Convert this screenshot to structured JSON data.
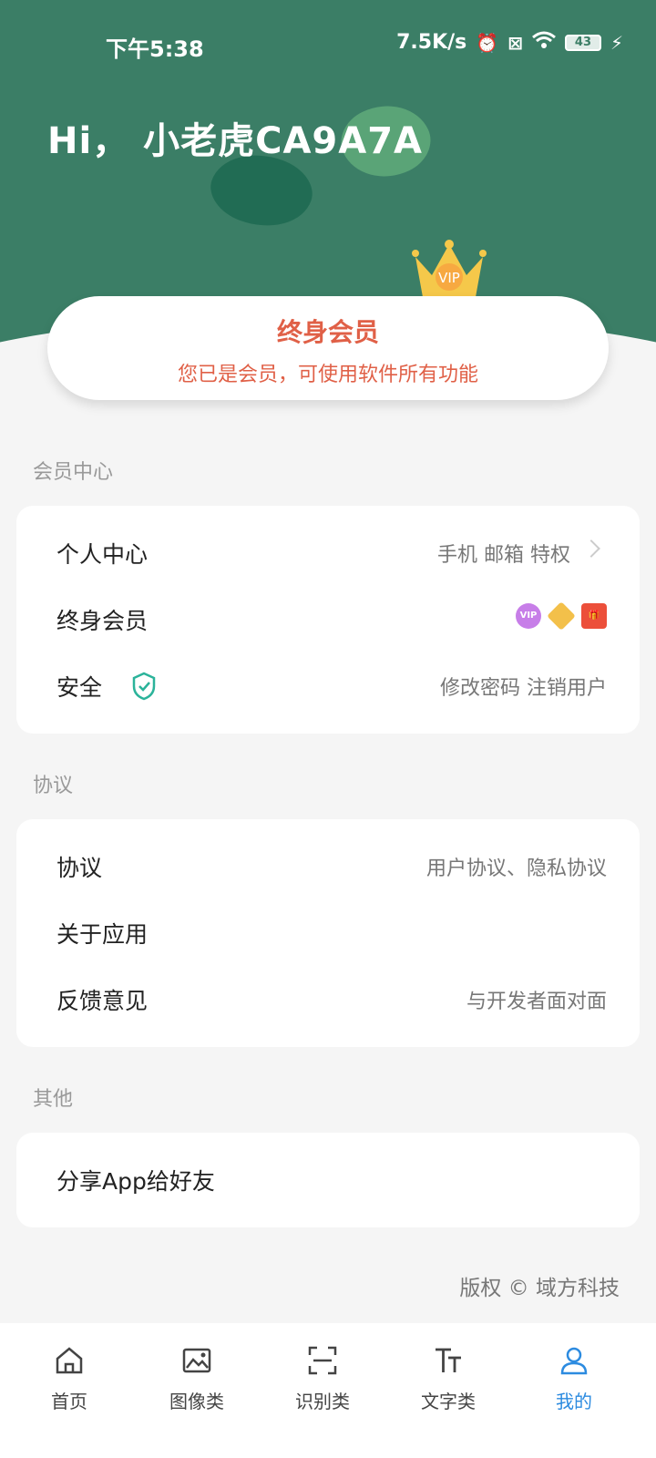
{
  "status_bar": {
    "time": "下午5:38",
    "net_speed": "7.5K/s",
    "battery": "43"
  },
  "header": {
    "greeting": "Hi， 小老虎CA9A7A",
    "crown_text": "VIP"
  },
  "vip_card": {
    "title": "终身会员",
    "subtitle": "您已是会员，可使用软件所有功能"
  },
  "sections": {
    "member": {
      "label": "会员中心",
      "rows": [
        {
          "title": "个人中心",
          "value": "手机 邮箱 特权"
        },
        {
          "title": "终身会员",
          "badges": [
            "VIP",
            "diamond",
            "gift"
          ]
        },
        {
          "title": "安全",
          "value": "修改密码   注销用户"
        }
      ]
    },
    "agreement": {
      "label": "协议",
      "rows": [
        {
          "title": "协议",
          "value": "用户协议、隐私协议"
        },
        {
          "title": "关于应用",
          "value": ""
        },
        {
          "title": "反馈意见",
          "value": "与开发者面对面"
        }
      ]
    },
    "other": {
      "label": "其他",
      "rows": [
        {
          "title": "分享App给好友"
        }
      ]
    }
  },
  "copyright": "版权 © 域方科技",
  "tabbar": {
    "tabs": [
      {
        "label": "首页",
        "icon": "home-icon"
      },
      {
        "label": "图像类",
        "icon": "image-icon"
      },
      {
        "label": "识别类",
        "icon": "scan-icon"
      },
      {
        "label": "文字类",
        "icon": "text-icon"
      },
      {
        "label": "我的",
        "icon": "user-icon"
      }
    ],
    "active_index": 4
  },
  "colors": {
    "header": "#3b7e66",
    "accent_red": "#e06047",
    "active_tab": "#2c8be0"
  }
}
